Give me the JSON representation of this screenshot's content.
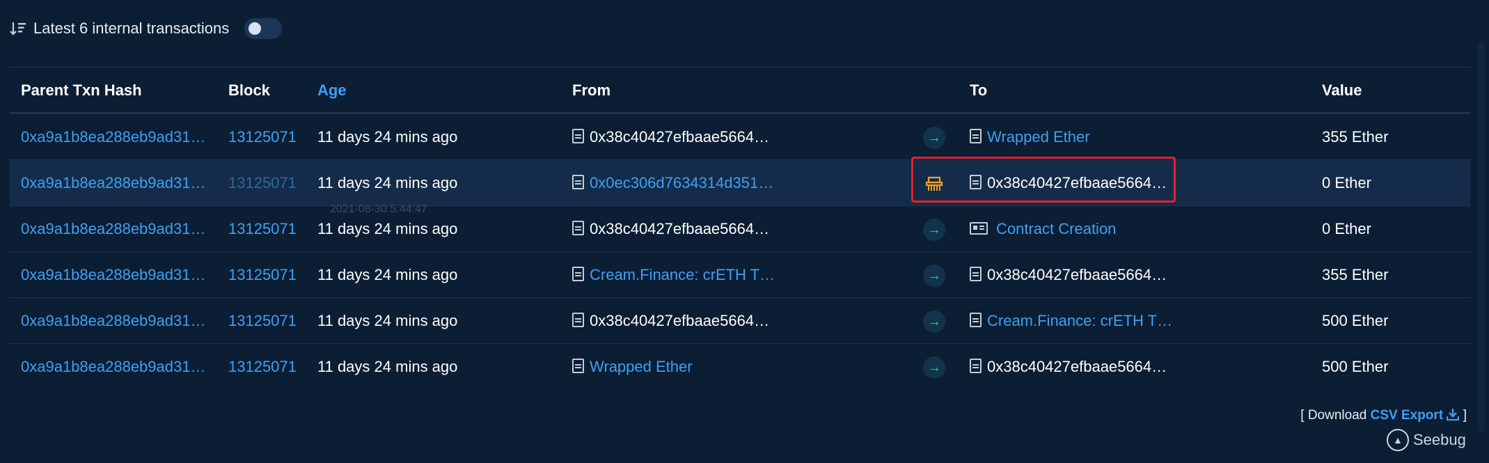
{
  "header": {
    "title": "Latest 6 internal transactions",
    "toggle_on": false
  },
  "columns": {
    "parent": "Parent Txn Hash",
    "block": "Block",
    "age": "Age",
    "from": "From",
    "to": "To",
    "value": "Value"
  },
  "rows": [
    {
      "parent": "0xa9a1b8ea288eb9ad31…",
      "block": "13125071",
      "age": "11 days 24 mins ago",
      "from": "0x38c40427efbaae5664…",
      "to": "Wrapped Ether",
      "value": "355 Ether"
    },
    {
      "parent": "0xa9a1b8ea288eb9ad31…",
      "block": "13125071",
      "age": "11 days 24 mins ago",
      "from": "0x0ec306d7634314d351…",
      "to": "0x38c40427efbaae5664…",
      "value": "0 Ether"
    },
    {
      "parent": "0xa9a1b8ea288eb9ad31…",
      "block": "13125071",
      "age": "11 days 24 mins ago",
      "from": "0x38c40427efbaae5664…",
      "to": "Contract Creation",
      "value": "0 Ether"
    },
    {
      "parent": "0xa9a1b8ea288eb9ad31…",
      "block": "13125071",
      "age": "11 days 24 mins ago",
      "from": "Cream.Finance: crETH T…",
      "to": "0x38c40427efbaae5664…",
      "value": "355 Ether"
    },
    {
      "parent": "0xa9a1b8ea288eb9ad31…",
      "block": "13125071",
      "age": "11 days 24 mins ago",
      "from": "0x38c40427efbaae5664…",
      "to": "Cream.Finance: crETH T…",
      "value": "500 Ether"
    },
    {
      "parent": "0xa9a1b8ea288eb9ad31…",
      "block": "13125071",
      "age": "11 days 24 mins ago",
      "from": "Wrapped Ether",
      "to": "0x38c40427efbaae5664…",
      "value": "500 Ether"
    }
  ],
  "tooltip": "2021-08-30 5:44:47",
  "footer": {
    "prefix": "[ Download ",
    "csv": "CSV Export",
    "suffix": " ]"
  },
  "watermark": "Seebug",
  "colors": {
    "background": "#0c1e34",
    "link": "#3fa0f2",
    "arrow": "#1fcf9a",
    "warning": "#f0a020",
    "highlight_box": "#e8202a"
  }
}
